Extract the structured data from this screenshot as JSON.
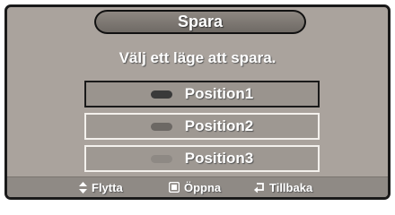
{
  "menu": {
    "title": "Spara",
    "prompt": "Välj ett läge att spara.",
    "options": [
      {
        "label": "Position1",
        "selected": true,
        "dot_color": "#3a3a3a"
      },
      {
        "label": "Position2",
        "selected": false,
        "dot_color": "#6c6864"
      },
      {
        "label": "Position3",
        "selected": false,
        "dot_color": "#8e8984"
      }
    ]
  },
  "hints": {
    "move": {
      "label": "Flytta",
      "icon": "up-down-arrow-icon"
    },
    "open": {
      "label": "Öppna",
      "icon": "enter-key-icon"
    },
    "back": {
      "label": "Tillbaka",
      "icon": "return-arrow-icon"
    }
  },
  "colors": {
    "panel_bg": "#aaa39d",
    "border_dark": "#1a1a1a",
    "text": "#ffffff"
  }
}
